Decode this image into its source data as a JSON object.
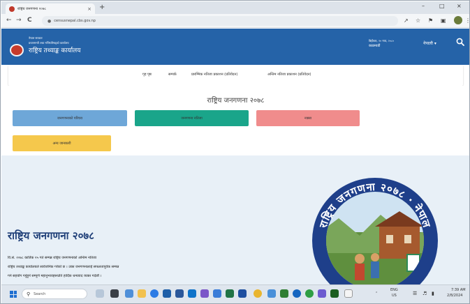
{
  "browser": {
    "tab_title": "राष्ट्रिय जनगणना २०७८",
    "tab_close": "×",
    "new_tab": "+",
    "window_controls": {
      "minimize": "–",
      "maximize": "□",
      "close": "×"
    },
    "url": "censusnepal.cbs.gov.np",
    "nav": {
      "back": "←",
      "forward": "→",
      "reload": "C"
    },
    "toolbar_icons": [
      "share-icon",
      "star-icon",
      "extensions-icon",
      "sidebar-icon",
      "profile-icon",
      "menu-icon"
    ]
  },
  "header": {
    "gov_line": "नेपाल सरकार",
    "ministry_line": "प्रधानमन्त्री तथा मन्त्रिपरिषद्‌को कार्यालय",
    "office_name": "राष्ट्रिय तथ्याङ्क कार्यालय",
    "date_line": "बिहीबार, २० माघ, २०८०",
    "place_line": "काठमाडौं",
    "language": "नेपाली",
    "accent": "#2563a8"
  },
  "nav": {
    "items": [
      "गृह पृष्ठ",
      "सम्पर्क",
      "प्रारम्भिक नतिजा प्रकाशन (प्रतिवेदन)",
      "अन्तिम नतिजा प्रकाशन (प्रतिवेदन)"
    ]
  },
  "content": {
    "title": "राष्ट्रिय जनगणना २०७८",
    "buttons": [
      {
        "label": "जनगणनाको परिचय",
        "color": "#6ea7d8"
      },
      {
        "label": "जनगणना नतिजा",
        "color": "#1aa58a"
      },
      {
        "label": "नक्सा",
        "color": "#f08c8c"
      },
      {
        "label": "अन्य जानकारी",
        "color": "#f5c84c"
      }
    ]
  },
  "banner": {
    "title": "राष्ट्रिय जनगणना २०७८",
    "paragraph_1": "वि.सं. २०७८ कार्तिक २५ गते सम्पन्न राष्ट्रिय जनगणनाको अन्तिम नतिजा",
    "paragraph_2": "राष्ट्रिय तथ्याङ्क कार्यालयले सार्वजनिक गरेको छ । उक्त जनगणनालाई सफलतापूर्वक सम्पन्न",
    "paragraph_3": "गर्न सहयोग गर्नुहुने सम्पूर्ण महानुभावहरूप्रति हार्दिक धन्यवाद व्यक्त गर्दछौं ।",
    "seal_text": "राष्ट्रिय जनगणना २०७८ नेपाल"
  },
  "taskbar": {
    "search_placeholder": "Search",
    "tray": {
      "lang_top": "ENG",
      "lang_bottom": "US",
      "time": "7:39 AM",
      "date": "2/8/2024"
    }
  }
}
